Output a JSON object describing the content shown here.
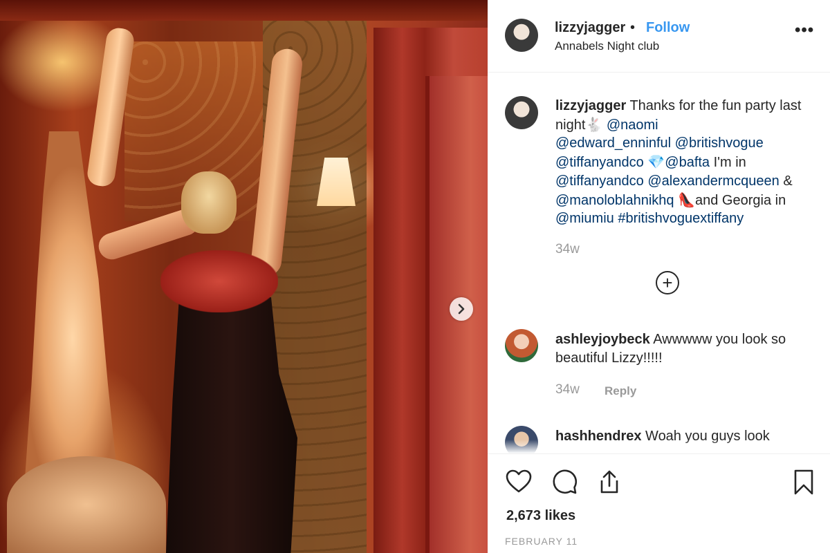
{
  "post": {
    "username": "lizzyjagger",
    "follow_label": "Follow",
    "separator": "•",
    "location": "Annabels Night club",
    "more_label": "•••"
  },
  "caption": {
    "username": "lizzyjagger",
    "text_1": "Thanks for the fun party last night",
    "emoji_1": "🐇",
    "mention_naomi": "@naomi",
    "mention_edward": "@edward_enninful",
    "mention_vogue": "@britishvogue",
    "mention_tiffany_1": "@tiffanyandco",
    "emoji_2": "💎",
    "mention_bafta": "@bafta",
    "text_2": "I'm in",
    "mention_tiffany_2": "@tiffanyandco",
    "mention_mcqueen": "@alexandermcqueen",
    "text_amp": "&",
    "mention_manolo": "@manoloblahnikhq",
    "emoji_3": "👠",
    "text_3": "and Georgia in",
    "mention_miumiu": "@miumiu",
    "hashtag": "#britishvoguextiffany",
    "age": "34w"
  },
  "load_more_label": "+",
  "comments": [
    {
      "username": "ashleyjoybeck",
      "text": "Awwwww you look so beautiful Lizzy!!!!!",
      "age": "34w",
      "reply_label": "Reply"
    },
    {
      "username": "hashhendrex",
      "text": "Woah you guys look"
    }
  ],
  "likes_text": "2,673 likes",
  "date_text": "FEBRUARY 11",
  "icons": [
    "heart-icon",
    "comment-icon",
    "share-icon",
    "bookmark-icon",
    "chevron-right-icon",
    "more-icon",
    "plus-circle-icon"
  ],
  "colors": {
    "link": "#3897f0",
    "mention": "#003569",
    "muted": "#999999",
    "text": "#262626"
  }
}
